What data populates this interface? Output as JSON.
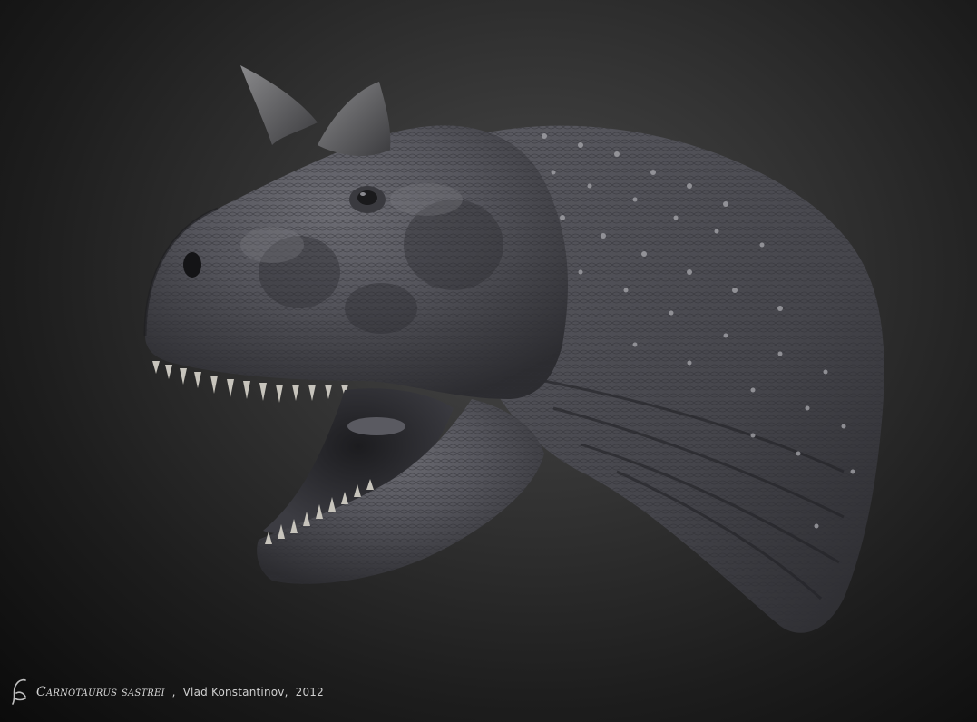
{
  "caption": {
    "species": "Carnotaurus sastrei",
    "separator": ",",
    "author": "Vlad Konstantinov,",
    "year": "2012"
  },
  "artwork": {
    "subject_icon": "dinosaur-head-sculpture",
    "logo_icon": "artist-signature-logo"
  },
  "colors": {
    "background_center": "#4a4a4a",
    "background_edge": "#0b0b0b",
    "skin": "#585860",
    "skin_shadow": "#2a2a2e",
    "caption_text": "#d8d8d8"
  }
}
